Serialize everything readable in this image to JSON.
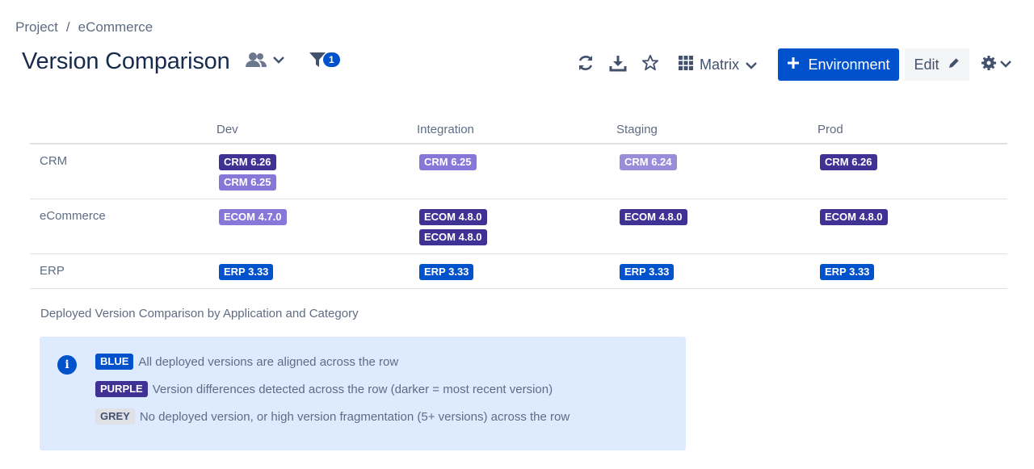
{
  "breadcrumb": {
    "project": "Project",
    "separator": "/",
    "current": "eCommerce"
  },
  "title": "Version Comparison",
  "filter_count": "1",
  "toolbar": {
    "view_label": "Matrix",
    "primary_label": "Environment",
    "edit_label": "Edit"
  },
  "columns": [
    "Dev",
    "Integration",
    "Staging",
    "Prod"
  ],
  "rows": [
    {
      "label": "CRM",
      "cells": [
        [
          "CRM 6.26",
          "CRM 6.25"
        ],
        [
          "CRM 6.25"
        ],
        [
          "CRM 6.24"
        ],
        [
          "CRM 6.26"
        ]
      ]
    },
    {
      "label": "eCommerce",
      "cells": [
        [
          "ECOM 4.7.0"
        ],
        [
          "ECOM 4.8.0",
          "ECOM 4.8.0"
        ],
        [
          "ECOM 4.8.0"
        ],
        [
          "ECOM 4.8.0"
        ]
      ]
    },
    {
      "label": "ERP",
      "cells": [
        [
          "ERP 3.33"
        ],
        [
          "ERP 3.33"
        ],
        [
          "ERP 3.33"
        ],
        [
          "ERP 3.33"
        ]
      ]
    }
  ],
  "caption": "Deployed Version Comparison by Application and Category",
  "legend": {
    "blue_tag": "BLUE",
    "blue_text": "All deployed versions are aligned across the row",
    "purple_tag": "PURPLE",
    "purple_text": "Version differences detected across the row (darker = most recent version)",
    "grey_tag": "GREY",
    "grey_text": "No deployed version, or high version fragmentation (5+ versions) across the row"
  },
  "colors": {
    "primary": "#0052cc",
    "purple_dark": "#403294",
    "purple_light": "#8777d9",
    "info_bg": "#deebff"
  }
}
